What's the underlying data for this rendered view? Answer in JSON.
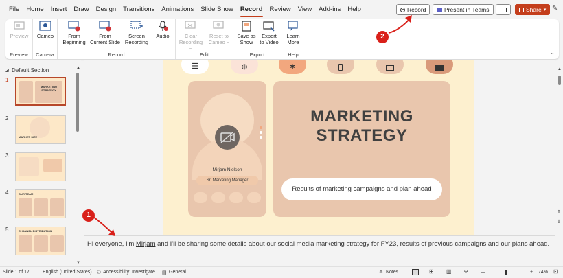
{
  "menu": {
    "tabs": [
      "File",
      "Home",
      "Insert",
      "Draw",
      "Design",
      "Transitions",
      "Animations",
      "Slide Show",
      "Record",
      "Review",
      "View",
      "Add-ins",
      "Help"
    ],
    "active_tab": "Record"
  },
  "top_buttons": {
    "record": "Record",
    "present_in_teams": "Present in Teams",
    "share": "Share"
  },
  "ribbon": {
    "groups": [
      {
        "name": "Preview",
        "buttons": [
          {
            "label": "Preview",
            "disabled": true
          }
        ]
      },
      {
        "name": "Camera",
        "buttons": [
          {
            "label": "Cameo",
            "disabled": false
          }
        ]
      },
      {
        "name": "Record",
        "buttons": [
          {
            "label": "From\nBeginning",
            "disabled": false
          },
          {
            "label": "From\nCurrent Slide",
            "disabled": false
          },
          {
            "label": "Screen\nRecording",
            "disabled": false
          },
          {
            "label": "Audio",
            "disabled": false
          }
        ]
      },
      {
        "name": "Edit",
        "buttons": [
          {
            "label": "Clear\nRecording ~",
            "disabled": true
          },
          {
            "label": "Reset to\nCameo ~",
            "disabled": true
          }
        ]
      },
      {
        "name": "Export",
        "buttons": [
          {
            "label": "Save as\nShow",
            "disabled": false
          },
          {
            "label": "Export\nto Video",
            "disabled": false
          }
        ]
      },
      {
        "name": "Help",
        "buttons": [
          {
            "label": "Learn\nMore",
            "disabled": false
          }
        ]
      }
    ]
  },
  "thumbnails": {
    "section": "Default Section",
    "slides": [
      {
        "num": "1",
        "caption": "MARKETING STRATEGY",
        "active": true
      },
      {
        "num": "2",
        "caption": "MARKET SIZE",
        "active": false
      },
      {
        "num": "3",
        "caption": "",
        "active": false
      },
      {
        "num": "4",
        "caption": "OUR TEAM",
        "active": false
      },
      {
        "num": "5",
        "caption": "CHANNEL DISTRIBUTION",
        "active": false
      }
    ]
  },
  "slide": {
    "title_line1": "MARKETING",
    "title_line2": "STRATEGY",
    "subtitle": "Results of marketing campaigns and plan ahead",
    "person_name": "Mirjam Nielson",
    "person_role": "Sr. Marketing Manager",
    "nav_colors": [
      "#ffffff",
      "#fbe3d8",
      "#f2a77e",
      "#e9c6ad",
      "#e9c6ad",
      "#d99a7a"
    ]
  },
  "notes": {
    "text_before": "Hi everyone, I'm ",
    "name": "Mirjam",
    "text_after": " and I'll be sharing some details about our social media marketing strategy for FY23, results of previous campaigns and our plans ahead."
  },
  "status": {
    "slide_count": "Slide 1 of 17",
    "language": "English (United States)",
    "accessibility": "Accessibility: Investigate",
    "sensitivity": "General",
    "notes": "Notes",
    "zoom": "74%"
  },
  "annotations": {
    "badge1": "1",
    "badge2": "2"
  },
  "colors": {
    "accent": "#c43e1c",
    "annotation": "#d9201a",
    "slide_bg": "#fdf0cf",
    "card": "#e9c6ad"
  }
}
